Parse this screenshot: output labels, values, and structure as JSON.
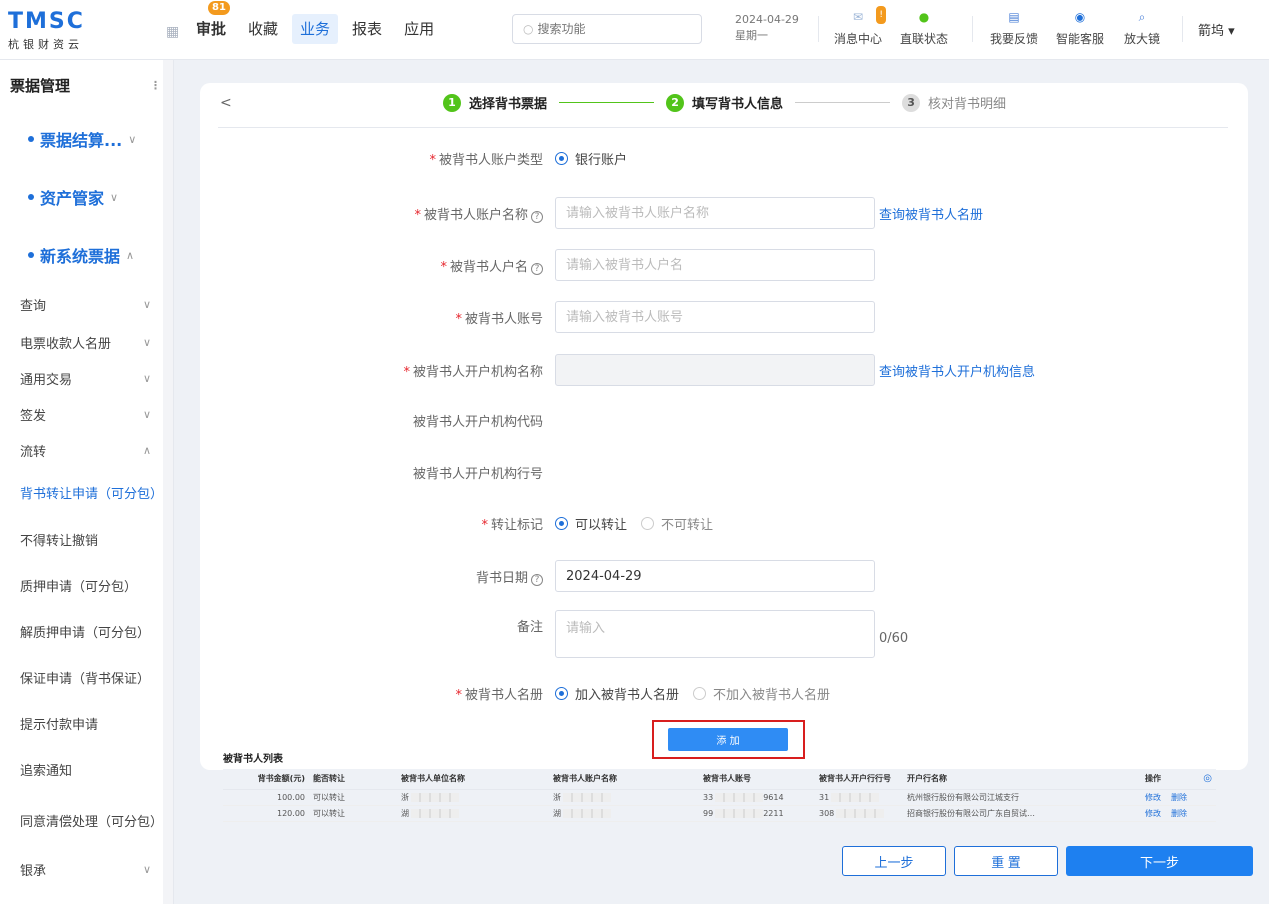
{
  "app": {
    "logo": "TMSC",
    "logo_sub": "杭银财资云"
  },
  "nav": {
    "items": [
      {
        "label": "审批",
        "badge": "81"
      },
      {
        "label": "收藏"
      },
      {
        "label": "业务"
      },
      {
        "label": "报表"
      },
      {
        "label": "应用"
      }
    ]
  },
  "search": {
    "placeholder": "搜索功能"
  },
  "date": {
    "day": "2024-04-29",
    "weekday": "星期一"
  },
  "tools": [
    {
      "label": "消息中心",
      "icon": "mail-icon",
      "badge": "!"
    },
    {
      "label": "直联状态",
      "icon": "status-icon"
    },
    {
      "label": "我要反馈",
      "icon": "feedback-icon"
    },
    {
      "label": "智能客服",
      "icon": "service-icon"
    },
    {
      "label": "放大镜",
      "icon": "magnifier-icon"
    }
  ],
  "user": {
    "name": "箭坞 ▾"
  },
  "sidebar": {
    "title": "票据管理",
    "groups": [
      {
        "label": "票据结算..."
      },
      {
        "label": "资产管家"
      },
      {
        "label": "新系统票据"
      }
    ],
    "items": [
      {
        "label": "查询"
      },
      {
        "label": "电票收款人名册"
      },
      {
        "label": "通用交易"
      },
      {
        "label": "签发"
      },
      {
        "label": "流转"
      },
      {
        "label": "背书转让申请（可分包）"
      },
      {
        "label": "不得转让撤销"
      },
      {
        "label": "质押申请（可分包）"
      },
      {
        "label": "解质押申请（可分包）"
      },
      {
        "label": "保证申请（背书保证）"
      },
      {
        "label": "提示付款申请"
      },
      {
        "label": "追索通知"
      },
      {
        "label": "同意清偿处理（可分包）"
      },
      {
        "label": "银承"
      }
    ]
  },
  "steps": [
    {
      "num": "1",
      "label": "选择背书票据"
    },
    {
      "num": "2",
      "label": "填写背书人信息"
    },
    {
      "num": "3",
      "label": "核对背书明细"
    }
  ],
  "back": "<",
  "form": {
    "account_type": {
      "label": "被背书人账户类型",
      "option": "银行账户"
    },
    "account_name": {
      "label": "被背书人账户名称",
      "placeholder": "请输入被背书人账户名称",
      "link": "查询被背书人名册"
    },
    "holder_name": {
      "label": "被背书人户名",
      "placeholder": "请输入被背书人户名"
    },
    "account_no": {
      "label": "被背书人账号",
      "placeholder": "请输入被背书人账号"
    },
    "bank_name": {
      "label": "被背书人开户机构名称",
      "link": "查询被背书人开户机构信息"
    },
    "bank_code": {
      "label": "被背书人开户机构代码"
    },
    "bank_line": {
      "label": "被背书人开户机构行号"
    },
    "transfer": {
      "label": "转让标记",
      "opt1": "可以转让",
      "opt2": "不可转让"
    },
    "date": {
      "label": "背书日期",
      "value": "2024-04-29"
    },
    "remark": {
      "label": "备注",
      "placeholder": "请输入",
      "count": "0/60"
    },
    "roster": {
      "label": "被背书人名册",
      "opt1": "加入被背书人名册",
      "opt2": "不加入被背书人名册"
    },
    "add": "添 加"
  },
  "table": {
    "title": "被背书人列表",
    "headers": [
      "背书金额(元)",
      "能否转让",
      "被背书人单位名称",
      "被背书人账户名称",
      "被背书人账号",
      "被背书人开户行行号",
      "开户行名称",
      "",
      "操作"
    ],
    "rows": [
      {
        "amount": "100.00",
        "transfer": "可以转让",
        "unit": "浙",
        "acct": "浙",
        "no": "33",
        "no_tail": "9614",
        "line": "31",
        "bank": "杭州银行股份有限公司江城支行",
        "edit": "修改",
        "del": "删除"
      },
      {
        "amount": "120.00",
        "transfer": "可以转让",
        "unit": "湖",
        "acct": "湖",
        "no": "99",
        "no_tail": "2211",
        "line": "308",
        "bank": "招商银行股份有限公司广东自贸试…",
        "edit": "修改",
        "del": "删除"
      }
    ]
  },
  "buttons": {
    "prev": "上一步",
    "reset": "重 置",
    "next": "下一步"
  }
}
